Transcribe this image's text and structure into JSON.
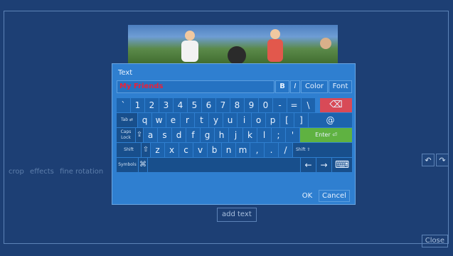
{
  "window": {
    "title": "",
    "status_hint": ""
  },
  "side_menu": [
    "crop",
    "effects",
    "fine rotation"
  ],
  "buttons": {
    "add_text": "add text",
    "close": "Close",
    "rotate_left": "↶",
    "rotate_right": "↷"
  },
  "dialog": {
    "title": "Text",
    "text_value": "My Friends",
    "bold": "B",
    "italic": "I",
    "color": "Color",
    "font": "Font",
    "ok": "OK",
    "cancel": "Cancel"
  },
  "keyboard": {
    "row1": [
      "`",
      "1",
      "2",
      "3",
      "4",
      "5",
      "6",
      "7",
      "8",
      "9",
      "0",
      "-",
      "=",
      "\\"
    ],
    "backspace": "⌫",
    "tab": "Tab ⇄",
    "row2": [
      "q",
      "w",
      "e",
      "r",
      "t",
      "y",
      "u",
      "i",
      "o",
      "p",
      "[",
      "]"
    ],
    "at": "@",
    "caps": "Caps Lock",
    "caps_arrow": "⇪",
    "row3": [
      "a",
      "s",
      "d",
      "f",
      "g",
      "h",
      "j",
      "k",
      "l",
      ";",
      "'"
    ],
    "enter": "Enter ⏎",
    "shift_left": "Shift",
    "shift_arrow": "⇧",
    "row4": [
      "z",
      "x",
      "c",
      "v",
      "b",
      "n",
      "m",
      ",",
      ".",
      "/"
    ],
    "shift_right": "Shift ⇧",
    "symbols": "Symbols",
    "cmd": "⌘",
    "arrow_left": "←",
    "arrow_right": "→",
    "kbd": "⌨"
  },
  "colors": {
    "background": "#1d3f74",
    "dialog": "#2f7fd0",
    "key": "#1d63ad",
    "delete": "#d84a57",
    "enter": "#5fb241",
    "text_value": "#e8223b"
  }
}
